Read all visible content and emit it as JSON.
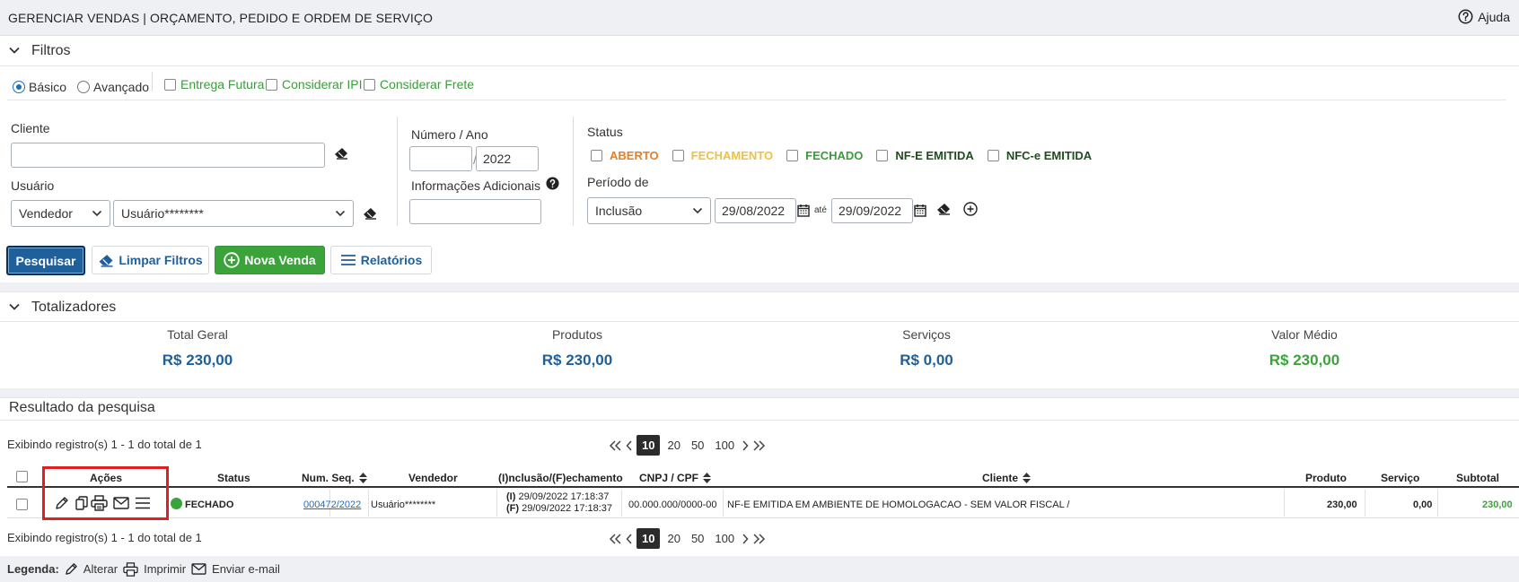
{
  "header": {
    "title": "GERENCIAR VENDAS | ORÇAMENTO, PEDIDO E ORDEM DE SERVIÇO",
    "help_label": "Ajuda"
  },
  "filters": {
    "section_label": "Filtros",
    "mode_basic": "Básico",
    "mode_advanced": "Avançado",
    "opt_future_delivery": "Entrega Futura",
    "opt_ipi": "Considerar IPI",
    "opt_freight": "Considerar Frete",
    "client_label": "Cliente",
    "client_value": "",
    "user_label": "Usuário",
    "user_type_selected": "Vendedor",
    "user_selected": "Usuário********",
    "number_year_label": "Número / Ano",
    "number_value": "",
    "year_value": "2022",
    "additional_info_label": "Informações Adicionais",
    "additional_info_value": "",
    "status_label": "Status",
    "statuses": [
      {
        "label": "ABERTO",
        "color": "#e67e22"
      },
      {
        "label": "FECHAMENTO",
        "color": "#f0c040"
      },
      {
        "label": "FECHADO",
        "color": "#3a9d3a"
      },
      {
        "label": "NF-E EMITIDA",
        "color": "#1e4d1e"
      },
      {
        "label": "NFC-e EMITIDA",
        "color": "#1e4d1e"
      }
    ],
    "period_label": "Período de",
    "period_type_selected": "Inclusão",
    "date_from": "29/08/2022",
    "date_to_label": "até",
    "date_to": "29/09/2022"
  },
  "actions": {
    "search": "Pesquisar",
    "clear_filters": "Limpar Filtros",
    "new_sale": "Nova Venda",
    "reports": "Relatórios"
  },
  "totals": {
    "section_label": "Totalizadores",
    "items": [
      {
        "label": "Total Geral",
        "value": "R$ 230,00",
        "color": "#1f5f9a"
      },
      {
        "label": "Produtos",
        "value": "R$ 230,00",
        "color": "#1f5f9a"
      },
      {
        "label": "Serviços",
        "value": "R$ 0,00",
        "color": "#1f5f9a"
      },
      {
        "label": "Valor Médio",
        "value": "R$ 230,00",
        "color": "#3aa43a"
      }
    ]
  },
  "results": {
    "section_label": "Resultado da pesquisa",
    "records_info": "Exibindo registro(s) 1 - 1 do total de 1",
    "page_sizes": [
      "10",
      "20",
      "50",
      "100"
    ],
    "active_page_size": "10",
    "columns": {
      "actions": "Ações",
      "status": "Status",
      "seq": "Num. Seq.",
      "seller": "Vendedor",
      "dates": "(I)nclusão/(F)echamento",
      "doc": "CNPJ / CPF",
      "client": "Cliente",
      "product": "Produto",
      "service": "Serviço",
      "subtotal": "Subtotal"
    },
    "rows": [
      {
        "status": "FECHADO",
        "status_color": "#3aa43a",
        "seq": "000472/2022",
        "seller": "Usuário********",
        "inclusion_tag": "(I)",
        "inclusion": "29/09/2022 17:18:37",
        "closing_tag": "(F)",
        "closing": "29/09/2022 17:18:37",
        "doc": "00.000.000/0000-00",
        "client": "NF-E EMITIDA EM AMBIENTE DE HOMOLOGACAO - SEM VALOR FISCAL /",
        "product": "230,00",
        "service": "0,00",
        "subtotal": "230,00"
      }
    ]
  },
  "legend": {
    "title": "Legenda:",
    "edit": "Alterar",
    "print": "Imprimir",
    "email": "Enviar e-mail"
  },
  "highlight_color": "#e02020"
}
